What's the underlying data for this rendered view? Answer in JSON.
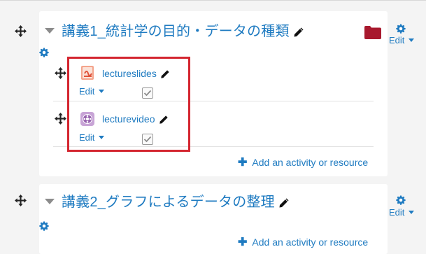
{
  "sections": [
    {
      "title": "講義1_統計学の目的・データの種類",
      "edit_label": "Edit",
      "activities": [
        {
          "name": "lectureslides",
          "type": "pdf",
          "edit_label": "Edit"
        },
        {
          "name": "lecturevideo",
          "type": "video",
          "edit_label": "Edit"
        }
      ],
      "add_label": "Add an activity or resource"
    },
    {
      "title": "講義2_グラフによるデータの整理",
      "edit_label": "Edit",
      "add_label": "Add an activity or resource"
    }
  ],
  "colors": {
    "link": "#1f7bc1",
    "highlight": "#d42630",
    "folder": "#a8192e"
  }
}
